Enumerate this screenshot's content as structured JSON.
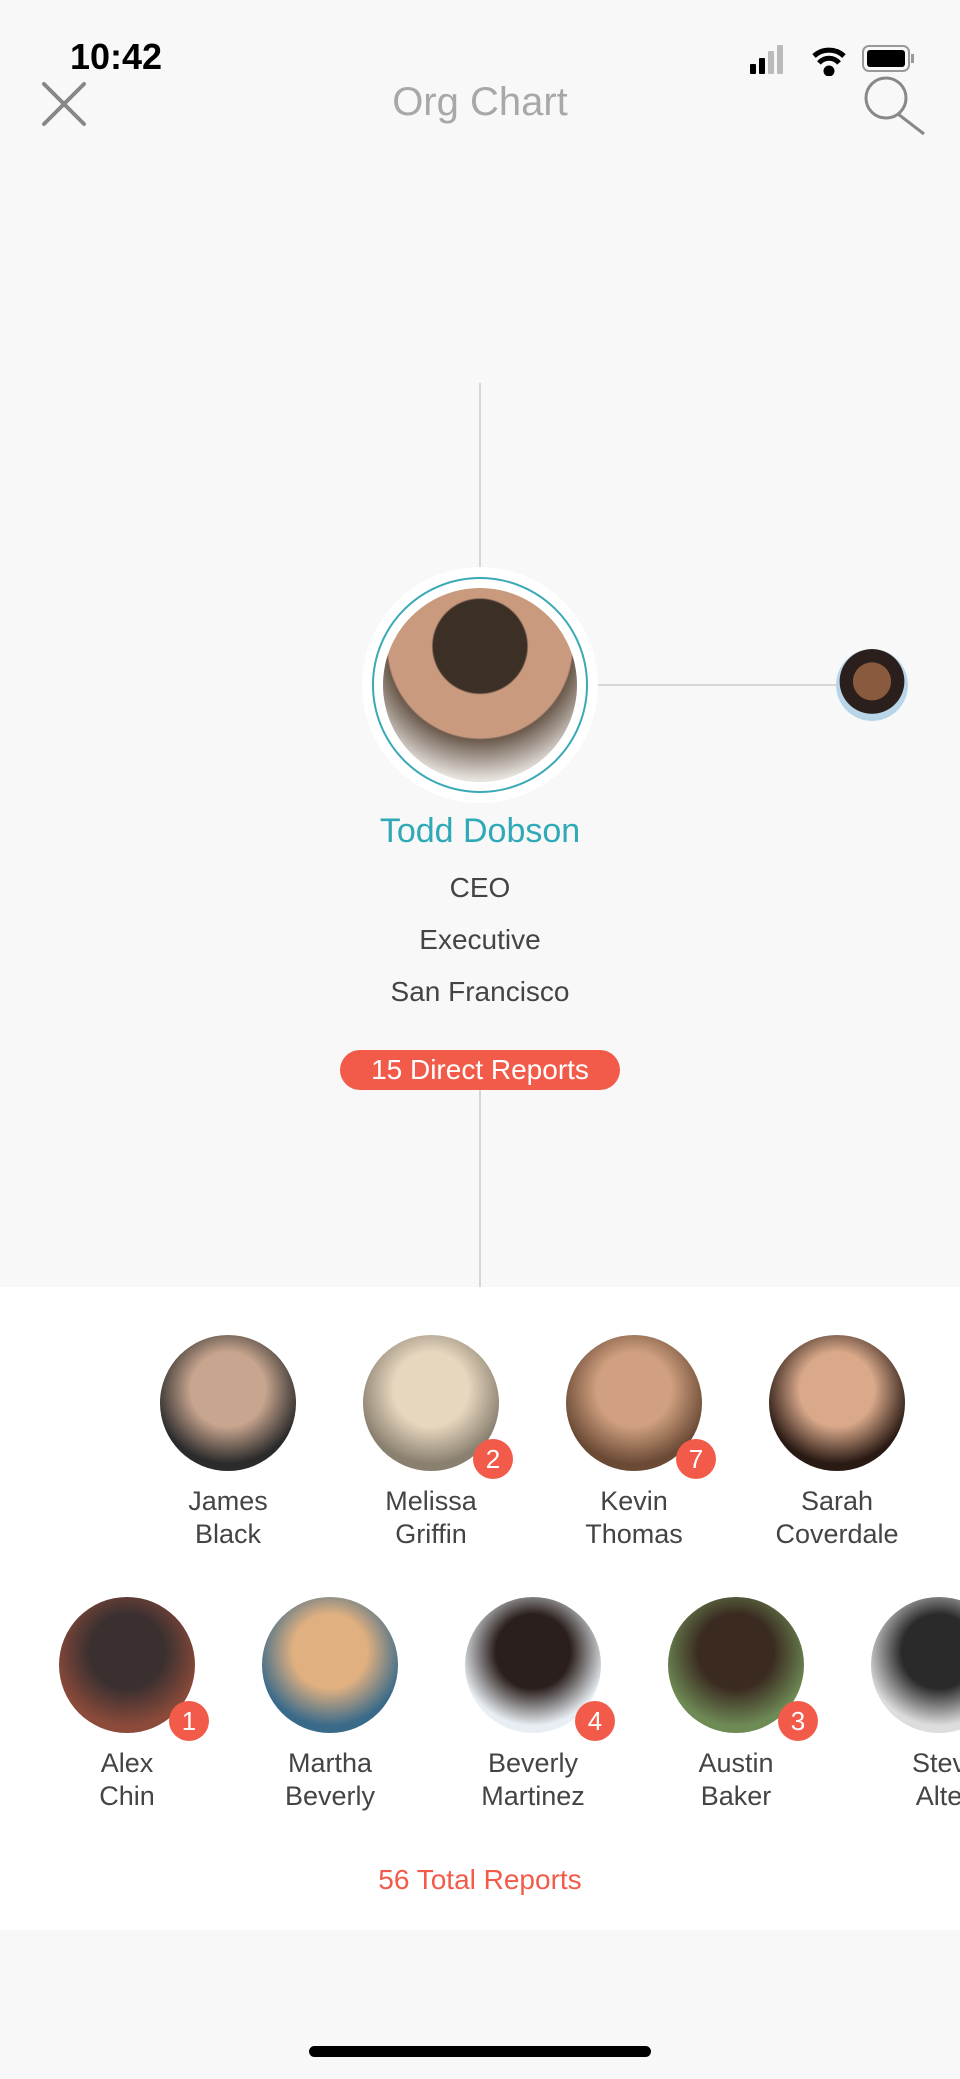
{
  "status_bar": {
    "time": "10:42"
  },
  "nav": {
    "title": "Org Chart",
    "close_icon": "close-icon",
    "search_icon": "search-icon"
  },
  "focus": {
    "name": "Todd Dobson",
    "title": "CEO",
    "department": "Executive",
    "location": "San Francisco",
    "direct_reports": "15 Direct Reports"
  },
  "colors": {
    "accent": "#2fa8b8",
    "badge": "#f25b4a",
    "background": "#f8f8f8"
  },
  "reports_row1": [
    {
      "first": "James",
      "last": "Black",
      "count": null
    },
    {
      "first": "Melissa",
      "last": "Griffin",
      "count": "2"
    },
    {
      "first": "Kevin",
      "last": "Thomas",
      "count": "7"
    },
    {
      "first": "Sarah",
      "last": "Coverdale",
      "count": null
    }
  ],
  "reports_row2": [
    {
      "first": "Alex",
      "last": "Chin",
      "count": "1"
    },
    {
      "first": "Martha",
      "last": "Beverly",
      "count": null
    },
    {
      "first": "Beverly",
      "last": "Martinez",
      "count": "4"
    },
    {
      "first": "Austin",
      "last": "Baker",
      "count": "3"
    },
    {
      "first": "Stev",
      "last": "Alte",
      "count": null
    }
  ],
  "total_reports": "56 Total Reports"
}
